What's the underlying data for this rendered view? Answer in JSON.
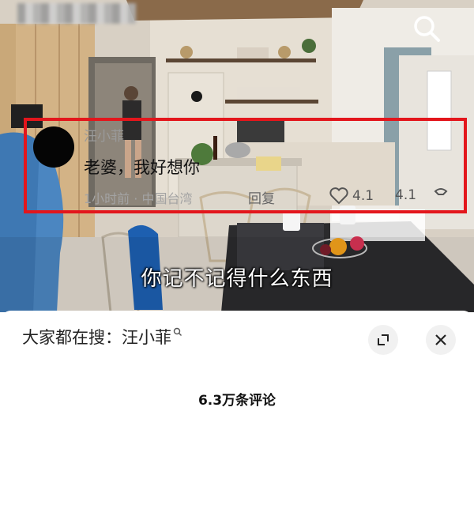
{
  "video": {
    "subtitle": "你记不记得什么东西",
    "search_icon": "search-icon"
  },
  "panel": {
    "trending_label": "大家都在搜：",
    "trending_term": "汪小菲",
    "expand_icon": "expand-icon",
    "close_icon": "close-icon",
    "comment_count": "6.3万条评论"
  },
  "comment": {
    "username": "汪小菲",
    "text": "老婆，我好想你",
    "time": "1小时前",
    "separator": " · ",
    "location": "中国台湾",
    "reply_label": "回复",
    "likes": "4.1",
    "likes_repeat": "4.1",
    "highlight_color": "#e3161c"
  }
}
